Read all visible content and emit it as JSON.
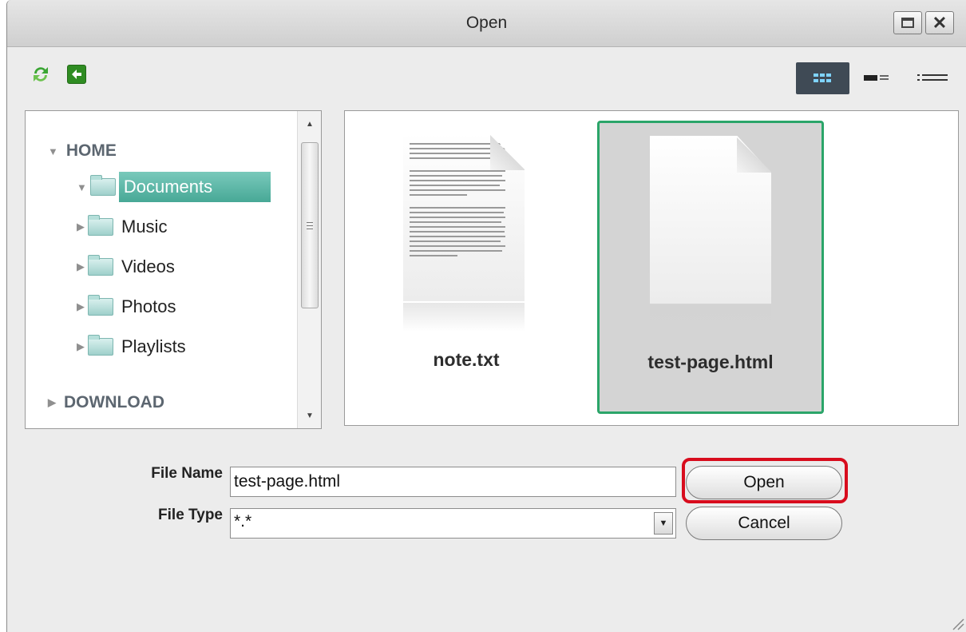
{
  "window": {
    "title": "Open"
  },
  "tree": {
    "roots": [
      {
        "label": "HOME"
      },
      {
        "label": "DOWNLOAD"
      }
    ],
    "items": [
      {
        "label": "Documents"
      },
      {
        "label": "Music"
      },
      {
        "label": "Videos"
      },
      {
        "label": "Photos"
      },
      {
        "label": "Playlists"
      }
    ]
  },
  "files": [
    {
      "name": "note.txt"
    },
    {
      "name": "test-page.html"
    }
  ],
  "form": {
    "file_name_label": "File Name",
    "file_name_value": "test-page.html",
    "file_type_label": "File Type",
    "file_type_value": "*.*",
    "open_label": "Open",
    "cancel_label": "Cancel"
  },
  "colors": {
    "selection": "#47a896",
    "selected_tile_border": "#2ba569",
    "highlight_ring": "#d80c1d",
    "back_button": "#2f8c22"
  },
  "icons": {
    "refresh": "refresh-icon",
    "back": "back-icon",
    "view_grid": "grid-view-icon",
    "view_detail": "detail-view-icon",
    "view_list": "list-view-icon"
  }
}
